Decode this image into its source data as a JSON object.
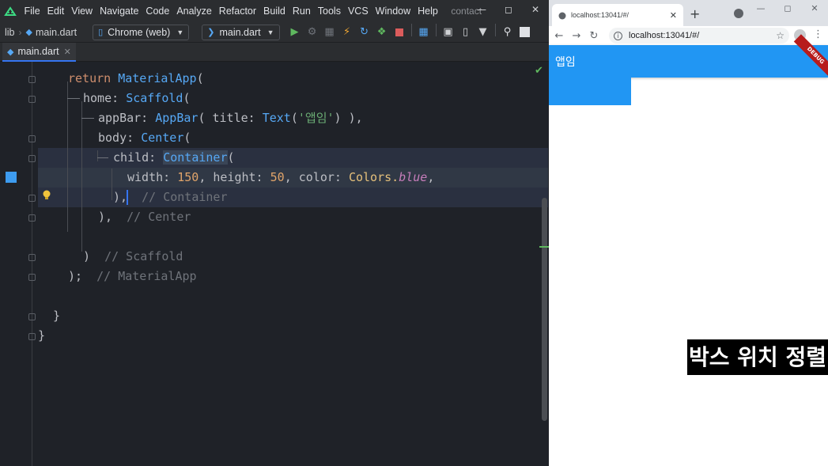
{
  "ide": {
    "menu": [
      "File",
      "Edit",
      "View",
      "Navigate",
      "Code",
      "Analyze",
      "Refactor",
      "Build",
      "Run",
      "Tools",
      "VCS",
      "Window",
      "Help"
    ],
    "project_name": "contact",
    "breadcrumb": [
      "lib",
      "main.dart"
    ],
    "device_selector": "Chrome (web)",
    "run_config": "main.dart",
    "tab": {
      "label": "main.dart"
    },
    "code": {
      "l1": {
        "kw": "return",
        "cls": "MaterialApp",
        "p": "("
      },
      "l2": {
        "param": "home:",
        "cls": "Scaffold",
        "p": "("
      },
      "l3": {
        "param": "appBar:",
        "cls": "AppBar",
        "p1": "(",
        "title": "title:",
        "text": "Text",
        "p2": "(",
        "str": "'앱임'",
        "p3": ") ),"
      },
      "l4": {
        "param": "body:",
        "cls": "Center",
        "p": "("
      },
      "l5": {
        "param": "child:",
        "cls": "Container",
        "p": "("
      },
      "l6": {
        "w": "width:",
        "wv": "150",
        "h": "height:",
        "hv": "50",
        "c": "color:",
        "colors": "Colors.",
        "blue": "blue",
        "end": ","
      },
      "l7": {
        "p": "),",
        "cm": "// Container"
      },
      "l8": {
        "p": "),",
        "cm": "// Center"
      },
      "l9": {
        "p": ")",
        "cm": "// Scaffold"
      },
      "l10": {
        "p": ");",
        "cm": "// MaterialApp"
      },
      "l11": {
        "p": "}"
      },
      "l12": {
        "p": "}"
      }
    }
  },
  "browser": {
    "tab_title": "localhost:13041/#/",
    "url": "localhost:13041/#/",
    "app_title": "앱임",
    "debug_banner": "DEBUG"
  },
  "caption": "박스 위치 정렬",
  "colors": {
    "flutter_blue": "#2196f3",
    "ide_bg": "#1f2228",
    "debug_red": "#b71c1c"
  }
}
